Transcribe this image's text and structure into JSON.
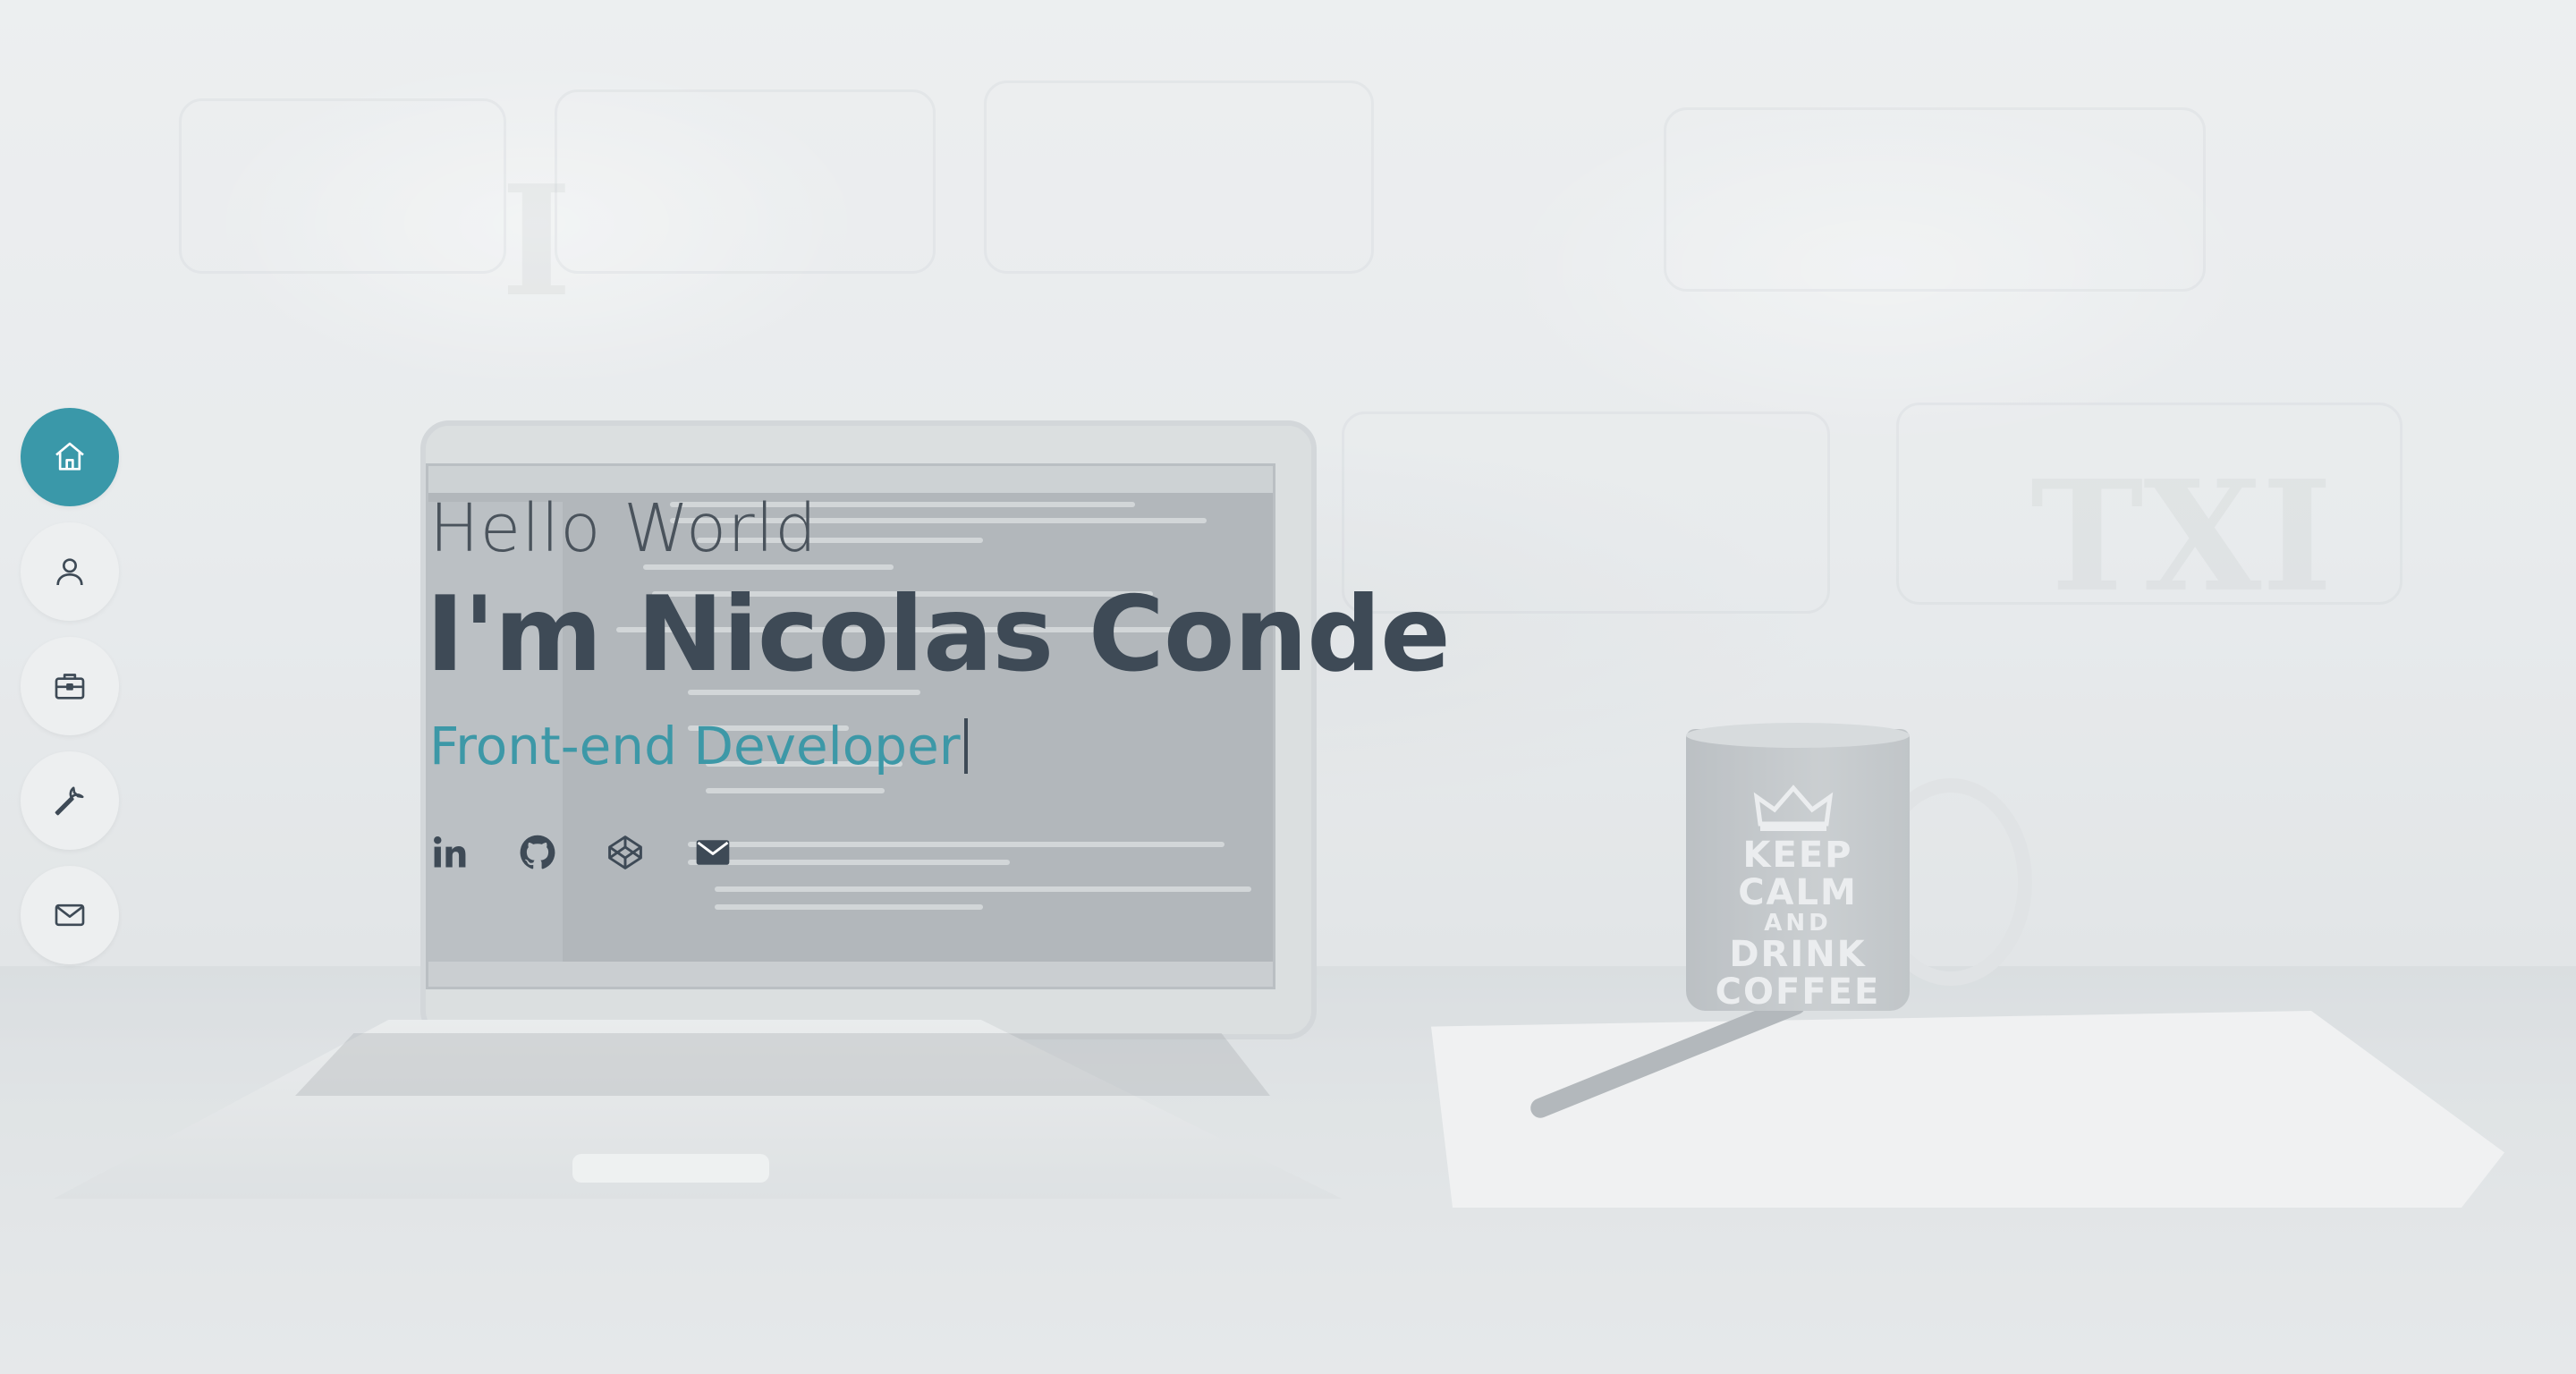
{
  "hero": {
    "greeting": "Hello World",
    "name": "I'm Nicolas Conde",
    "role": "Front-end Developer"
  },
  "nav": {
    "items": [
      {
        "icon": "home-icon",
        "active": true
      },
      {
        "icon": "user-icon",
        "active": false
      },
      {
        "icon": "briefcase-icon",
        "active": false
      },
      {
        "icon": "wrench-icon",
        "active": false
      },
      {
        "icon": "mail-icon",
        "active": false
      }
    ]
  },
  "social": [
    {
      "icon": "linkedin-icon"
    },
    {
      "icon": "github-icon"
    },
    {
      "icon": "codepen-icon"
    },
    {
      "icon": "mail-icon"
    }
  ],
  "background": {
    "mug": {
      "line1": "KEEP",
      "line2": "CALM",
      "line3": "AND",
      "line4": "DRINK",
      "line5": "COFFEE"
    }
  },
  "colors": {
    "accent": "#3a98a9",
    "heading": "#3e4a56",
    "nav_bg": "#edeff0"
  }
}
